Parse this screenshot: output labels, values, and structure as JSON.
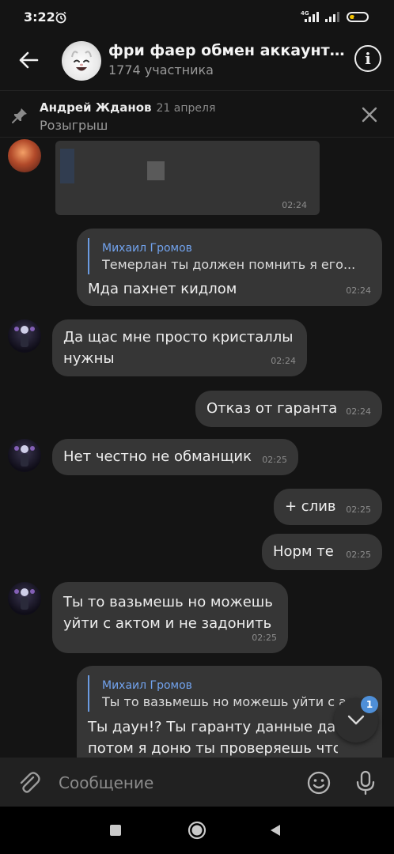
{
  "status_bar": {
    "time": "3:22",
    "network": "4G",
    "battery": "29",
    "battery_level": 0.29
  },
  "header": {
    "title": "фри фаер обмен аккаунтами...",
    "subtitle": "1774 участника"
  },
  "pinned": {
    "author": "Андрей Жданов",
    "date": "21 апреля",
    "text": "Розыгрыш"
  },
  "messages": [
    {
      "time": "02:24"
    },
    {
      "reply_to": "Михаил Громов",
      "reply_text": "Темерлан ты должен помнить я его...",
      "text": "Мда пахнет кидлом",
      "time": "02:24"
    },
    {
      "lines": [
        "Да щас мне просто кристаллы",
        "нужны"
      ],
      "time": "02:24"
    },
    {
      "text": "Отказ от гаранта",
      "time": "02:24"
    },
    {
      "text": "Нет честно не обманщик",
      "time": "02:25"
    },
    {
      "text": "+ слив",
      "time": "02:25"
    },
    {
      "text": "Норм те",
      "time": "02:25"
    },
    {
      "lines": [
        "Ты то вазьмешь но можешь",
        "уйти с актом и не задонить"
      ],
      "time": "02:25"
    },
    {
      "reply_to": "Михаил Громов",
      "reply_text": "Ты то вазьмешь но можешь уйти с а",
      "lines": [
        "Ты даун!? Ты гаранту данные дас",
        "потом я доню ты проверяешь что"
      ]
    }
  ],
  "scroll_button": {
    "unread_count": "1"
  },
  "composer": {
    "placeholder": "Сообщение"
  },
  "colors": {
    "background": "#141414",
    "bubble": "#363636",
    "accent": "#72a3ee",
    "badge": "#4e8fd8"
  }
}
